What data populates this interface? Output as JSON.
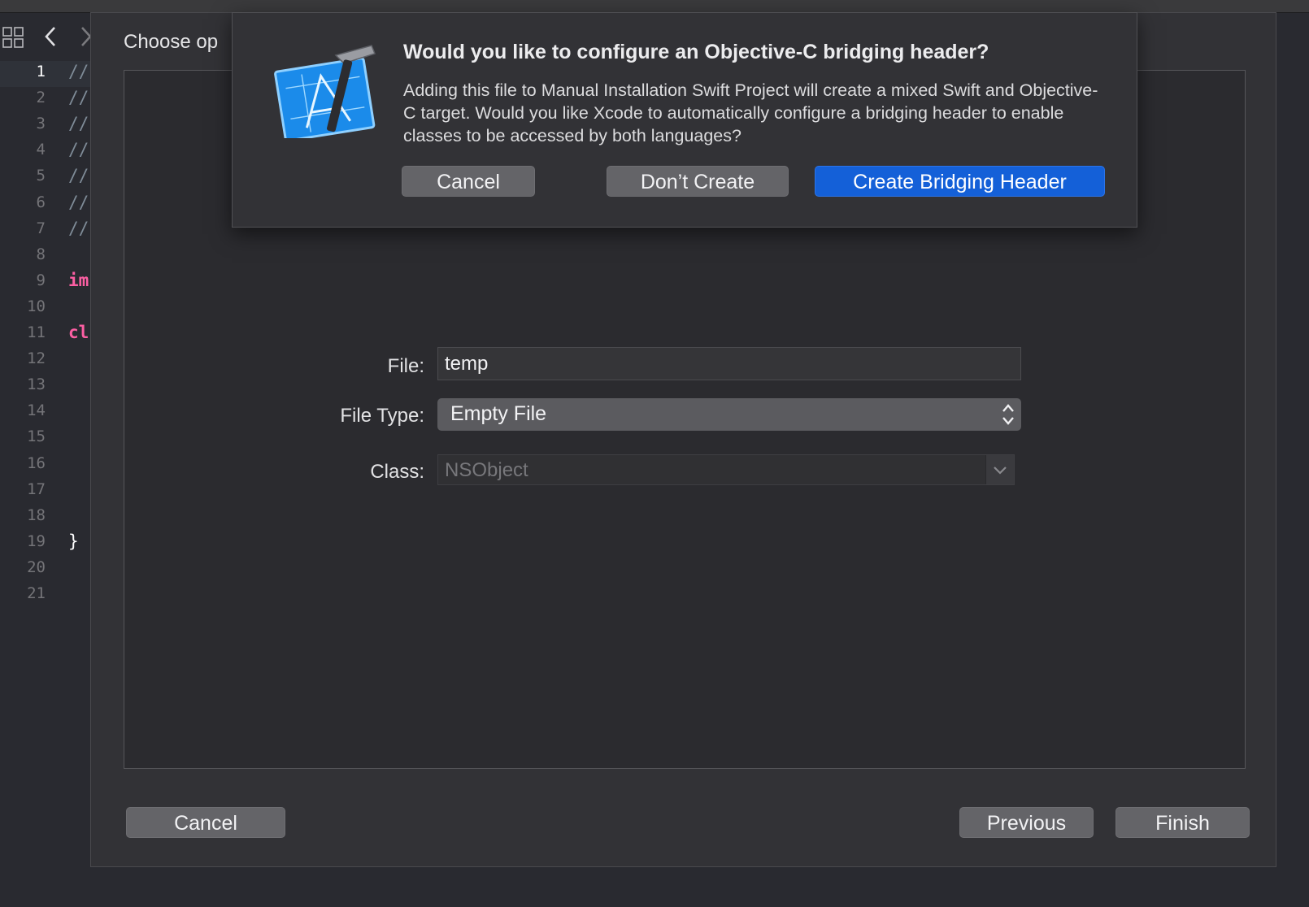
{
  "editor": {
    "lines": [
      {
        "num": "1",
        "text": "//",
        "kind": "comment",
        "current": true
      },
      {
        "num": "2",
        "text": "//",
        "kind": "comment"
      },
      {
        "num": "3",
        "text": "//",
        "kind": "comment"
      },
      {
        "num": "4",
        "text": "//",
        "kind": "comment"
      },
      {
        "num": "5",
        "text": "//",
        "kind": "comment"
      },
      {
        "num": "6",
        "text": "//",
        "kind": "comment"
      },
      {
        "num": "7",
        "text": "//",
        "kind": "comment"
      },
      {
        "num": "8",
        "text": "",
        "kind": "plain"
      },
      {
        "num": "9",
        "text": "im",
        "kind": "keyword"
      },
      {
        "num": "10",
        "text": "",
        "kind": "plain"
      },
      {
        "num": "11",
        "text": "cl",
        "kind": "keyword"
      },
      {
        "num": "12",
        "text": "",
        "kind": "plain"
      },
      {
        "num": "13",
        "text": "",
        "kind": "plain"
      },
      {
        "num": "14",
        "text": "",
        "kind": "plain"
      },
      {
        "num": "15",
        "text": "",
        "kind": "plain"
      },
      {
        "num": "16",
        "text": "",
        "kind": "plain"
      },
      {
        "num": "17",
        "text": "",
        "kind": "plain"
      },
      {
        "num": "18",
        "text": "",
        "kind": "plain"
      },
      {
        "num": "19",
        "text": "}",
        "kind": "plain"
      },
      {
        "num": "20",
        "text": "",
        "kind": "plain"
      },
      {
        "num": "21",
        "text": "",
        "kind": "plain"
      }
    ],
    "icons": {
      "grid": "grid-icon",
      "back": "chevron-left-icon",
      "forward": "chevron-right-icon"
    }
  },
  "sheet": {
    "title": "Choose op",
    "form": {
      "file_label": "File:",
      "file_value": "temp",
      "file_type_label": "File Type:",
      "file_type_value": "Empty File",
      "class_label": "Class:",
      "class_value": "NSObject"
    },
    "buttons": {
      "cancel": "Cancel",
      "previous": "Previous",
      "finish": "Finish"
    }
  },
  "alert": {
    "icon": "xcode-app-icon",
    "title": "Would you like to configure an Objective-C bridging header?",
    "body": "Adding this file to Manual Installation Swift Project will create a mixed Swift and Objective-C target. Would you like Xcode to automatically configure a bridging header to enable classes to be accessed by both languages?",
    "buttons": {
      "cancel": "Cancel",
      "dont_create": "Don’t Create",
      "create": "Create Bridging Header"
    }
  },
  "colors": {
    "accent": "#1460d8",
    "keyword": "#fc5fa3",
    "comment": "#7f8c98"
  }
}
